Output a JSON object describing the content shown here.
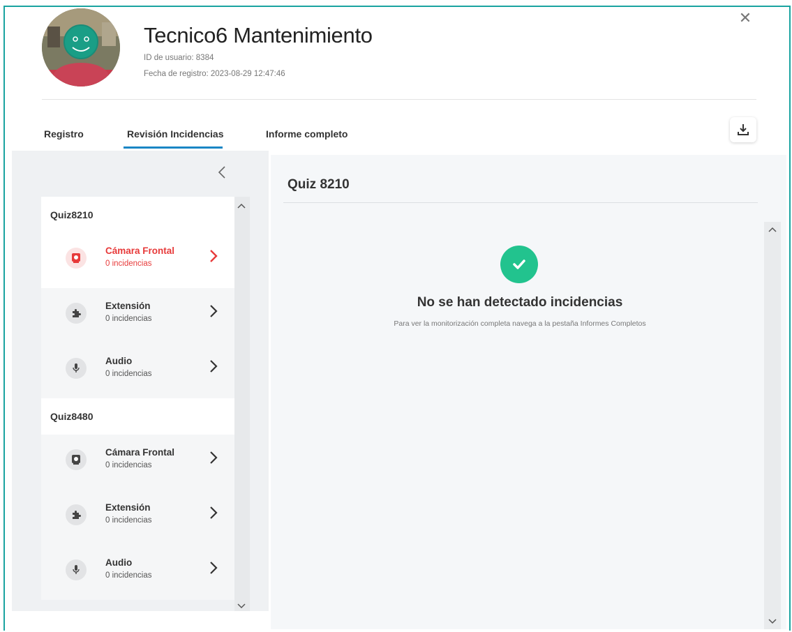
{
  "header": {
    "user_name": "Tecnico6 Mantenimiento",
    "user_id": "ID de usuario: 8384",
    "registered": "Fecha de registro: 2023-08-29 12:47:46",
    "close_symbol": "✕"
  },
  "tabs": [
    {
      "label": "Registro",
      "active": false
    },
    {
      "label": "Revisión Incidencias",
      "active": true
    },
    {
      "label": "Informe completo",
      "active": false
    }
  ],
  "sidebar": {
    "groups": [
      {
        "title": "Quiz8210",
        "items": [
          {
            "label": "Cámara Frontal",
            "count": "0 incidencias",
            "icon": "camera-icon",
            "selected": true
          },
          {
            "label": "Extensión",
            "count": "0 incidencias",
            "icon": "puzzle-icon",
            "selected": false
          },
          {
            "label": "Audio",
            "count": "0 incidencias",
            "icon": "microphone-icon",
            "selected": false
          }
        ]
      },
      {
        "title": "Quiz8480",
        "items": [
          {
            "label": "Cámara Frontal",
            "count": "0 incidencias",
            "icon": "camera-icon",
            "selected": false
          },
          {
            "label": "Extensión",
            "count": "0 incidencias",
            "icon": "puzzle-icon",
            "selected": false
          },
          {
            "label": "Audio",
            "count": "0 incidencias",
            "icon": "microphone-icon",
            "selected": false
          }
        ]
      }
    ]
  },
  "main": {
    "title": "Quiz 8210",
    "status_title": "No se han detectado incidencias",
    "status_text": "Para ver la monitorización completa navega a la pestaña Informes Completos"
  },
  "colors": {
    "accent": "#1a86c5",
    "frame": "#1aa3a0",
    "selected": "#e73a3a",
    "success": "#22c38e"
  }
}
